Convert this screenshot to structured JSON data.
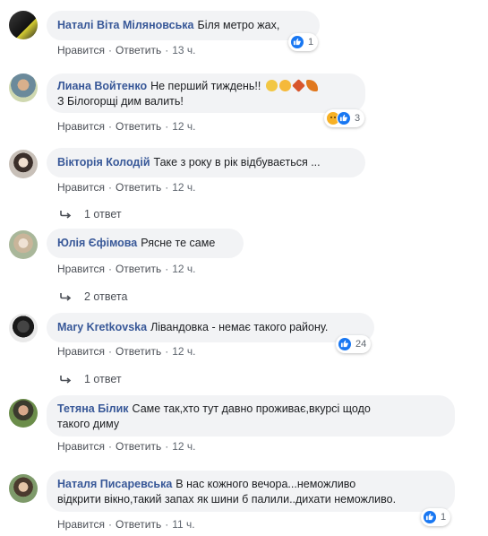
{
  "actions": {
    "like": "Нравится",
    "reply": "Ответить",
    "sep": "·"
  },
  "comments": [
    {
      "author": "Наталі Віта Міляновська",
      "text": "Біля метро жах,",
      "time": "13 ч.",
      "reaction_count": "1"
    },
    {
      "author": "Лиана Войтенко",
      "text": "Не перший тиждень!!",
      "text2": "З Білогорщі дим валить!",
      "time": "12 ч.",
      "reaction_count": "3"
    },
    {
      "author": "Вікторія Колодій",
      "text": "Таке з року в рік відбувається ...",
      "time": "12 ч.",
      "replies": "1 ответ"
    },
    {
      "author": "Юлія Єфімова",
      "text": "Рясне те саме",
      "time": "12 ч.",
      "replies": "2 ответа"
    },
    {
      "author": "Mary Kretkovska",
      "text": "Лівандовка - немає такого району.",
      "time": "12 ч.",
      "reaction_count": "24",
      "replies": "1 ответ"
    },
    {
      "author": "Тетяна Білик",
      "text": "Саме так,хто тут давно проживає,вкурсі щодо",
      "text2": "такого диму",
      "time": "12 ч."
    },
    {
      "author": "Наталя Писаревська",
      "text": "В нас кожного вечора...неможливо",
      "text2": "відкрити вікно,такий запах як шини б палили..дихати неможливо.",
      "time": "11 ч.",
      "reaction_count": "1"
    }
  ],
  "icons": [
    "like-icon",
    "sad-icon",
    "reply-arrow-icon"
  ],
  "colors": {
    "author": "#385898",
    "bubble": "#f2f3f5",
    "like": "#1877f2"
  }
}
